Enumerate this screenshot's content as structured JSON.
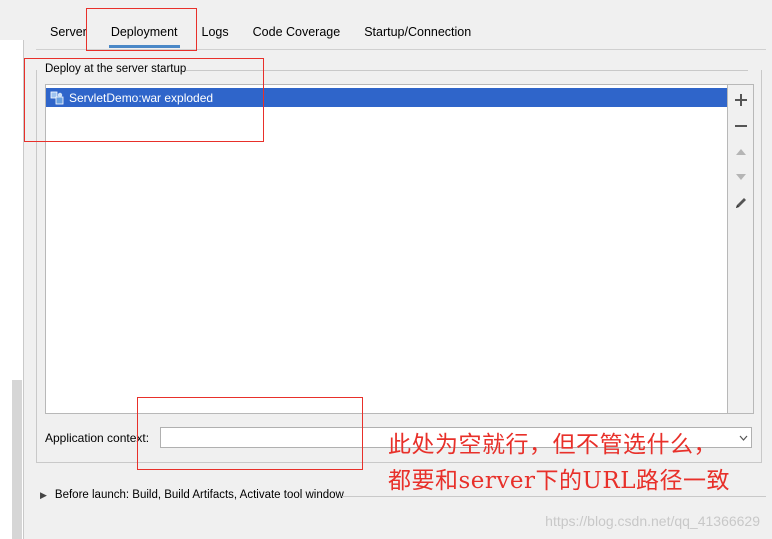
{
  "tabs": [
    {
      "label": "Server"
    },
    {
      "label": "Deployment"
    },
    {
      "label": "Logs"
    },
    {
      "label": "Code Coverage"
    },
    {
      "label": "Startup/Connection"
    }
  ],
  "active_tab": "Deployment",
  "deploy_group": {
    "title": "Deploy at the server startup",
    "items": [
      {
        "label": "ServletDemo:war exploded",
        "selected": true,
        "icon": "artifact-icon"
      }
    ]
  },
  "toolbar": {
    "add_icon": "plus-icon",
    "remove_icon": "minus-icon",
    "up_icon": "arrow-up-icon",
    "down_icon": "arrow-down-icon",
    "edit_icon": "pencil-icon"
  },
  "app_context": {
    "label": "Application context:",
    "value": ""
  },
  "before_launch": {
    "label": "Before launch: Build, Build Artifacts, Activate tool window"
  },
  "annotation": {
    "line1": "此处为空就行，但不管选什么，",
    "line2": "都要和server下的URL路径一致"
  },
  "watermark": "https://blog.csdn.net/qq_41366629",
  "colors": {
    "selection": "#2f65ca",
    "tab_indicator": "#4a88c7",
    "annotation": "#e8302a"
  }
}
